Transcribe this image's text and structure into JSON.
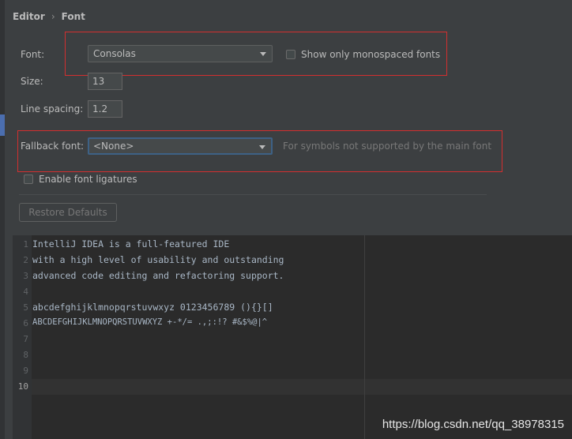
{
  "breadcrumb": {
    "parent": "Editor",
    "separator": "›",
    "current": "Font"
  },
  "font_row": {
    "label": "Font:",
    "value": "Consolas",
    "monospace_label": "Show only monospaced fonts",
    "monospace_checked": false
  },
  "size_row": {
    "label": "Size:",
    "value": "13"
  },
  "spacing_row": {
    "label": "Line spacing:",
    "value": "1.2"
  },
  "fallback_row": {
    "label": "Fallback font:",
    "value": "<None>",
    "hint": "For symbols not supported by the main font"
  },
  "ligatures": {
    "label": "Enable font ligatures",
    "checked": false
  },
  "restore_button": "Restore Defaults",
  "preview": {
    "line_numbers": [
      "1",
      "2",
      "3",
      "4",
      "5",
      "6",
      "7",
      "8",
      "9",
      "10"
    ],
    "lines": [
      "IntelliJ IDEA is a full-featured IDE",
      "with a high level of usability and outstanding",
      "advanced code editing and refactoring support.",
      "",
      "abcdefghijklmnopqrstuvwxyz 0123456789 (){}[]",
      "ABCDEFGHIJKLMNOPQRSTUVWXYZ +-*/= .,;:!? #&$%@|^",
      "",
      "",
      "",
      ""
    ]
  },
  "watermark": "https://blog.csdn.net/qq_38978315",
  "colors": {
    "highlight_box": "#d32f2f",
    "focus_border": "#3d6185"
  }
}
